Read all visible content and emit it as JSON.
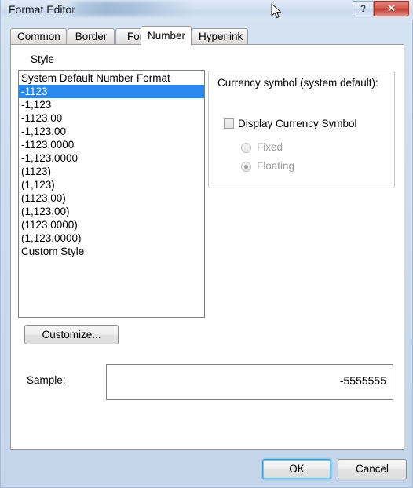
{
  "window": {
    "title": "Format Editor",
    "title_redacted": true,
    "help_button": "?",
    "close_button": "✕"
  },
  "tabs": [
    {
      "label": "Common",
      "active": false
    },
    {
      "label": "Border",
      "active": false
    },
    {
      "label": "Font",
      "active": false
    },
    {
      "label": "Number",
      "active": true
    },
    {
      "label": "Hyperlink",
      "active": false
    }
  ],
  "style": {
    "label": "Style",
    "items": [
      "System Default Number Format",
      "-1123",
      "-1,123",
      "-1123.00",
      "-1,123.00",
      "-1123.0000",
      "-1,123.0000",
      "(1123)",
      "(1,123)",
      "(1123.00)",
      "(1,123.00)",
      "(1123.0000)",
      "(1,123.0000)",
      "Custom Style"
    ],
    "selected_index": 1,
    "selected_value": "-1123"
  },
  "customize_button": {
    "label": "Customize..."
  },
  "currency": {
    "group_title": "Currency symbol (system default):",
    "checkbox": {
      "label": "Display Currency Symbol",
      "checked": false
    },
    "radios": [
      {
        "label": "Fixed",
        "selected": false,
        "disabled": true
      },
      {
        "label": "Floating",
        "selected": true,
        "disabled": true
      }
    ]
  },
  "sample": {
    "label": "Sample:",
    "value": "-5555555"
  },
  "footer": {
    "ok_label": "OK",
    "cancel_label": "Cancel"
  },
  "colors": {
    "selection_blue": "#2a8aef",
    "close_red": "#c03a2e",
    "focus_blue": "#3c9fd4",
    "panel_white": "#ffffff",
    "dialog_chrome": "#cddcee",
    "disabled_gray": "#9a9a9a"
  }
}
